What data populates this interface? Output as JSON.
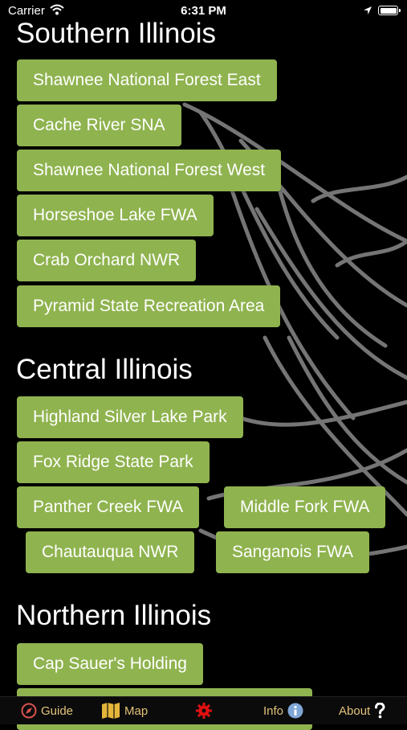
{
  "status": {
    "carrier": "Carrier",
    "time": "6:31 PM"
  },
  "sections": {
    "southern": "Southern Illinois",
    "central": "Central Illinois",
    "northern": "Northern Illinois"
  },
  "buttons": {
    "shawnee_east": "Shawnee National Forest East",
    "cache_river": "Cache River SNA",
    "shawnee_west": "Shawnee National Forest West",
    "horseshoe_lake": "Horseshoe Lake FWA",
    "crab_orchard": "Crab Orchard NWR",
    "pyramid": "Pyramid State Recreation Area",
    "highland": "Highland Silver Lake Park",
    "fox_ridge": "Fox Ridge State Park",
    "panther_creek": "Panther Creek FWA",
    "middle_fork": "Middle Fork FWA",
    "chautauqua": "Chautauqua NWR",
    "sanganois": "Sanganois FWA",
    "cap_sauer": "Cap Sauer's Holding"
  },
  "tabs": {
    "guide": "Guide",
    "map": "Map",
    "info": "Info",
    "about": "About"
  },
  "colors": {
    "button": "#8fb34f",
    "tab_text": "#e3c27a",
    "settings": "#e01010"
  }
}
